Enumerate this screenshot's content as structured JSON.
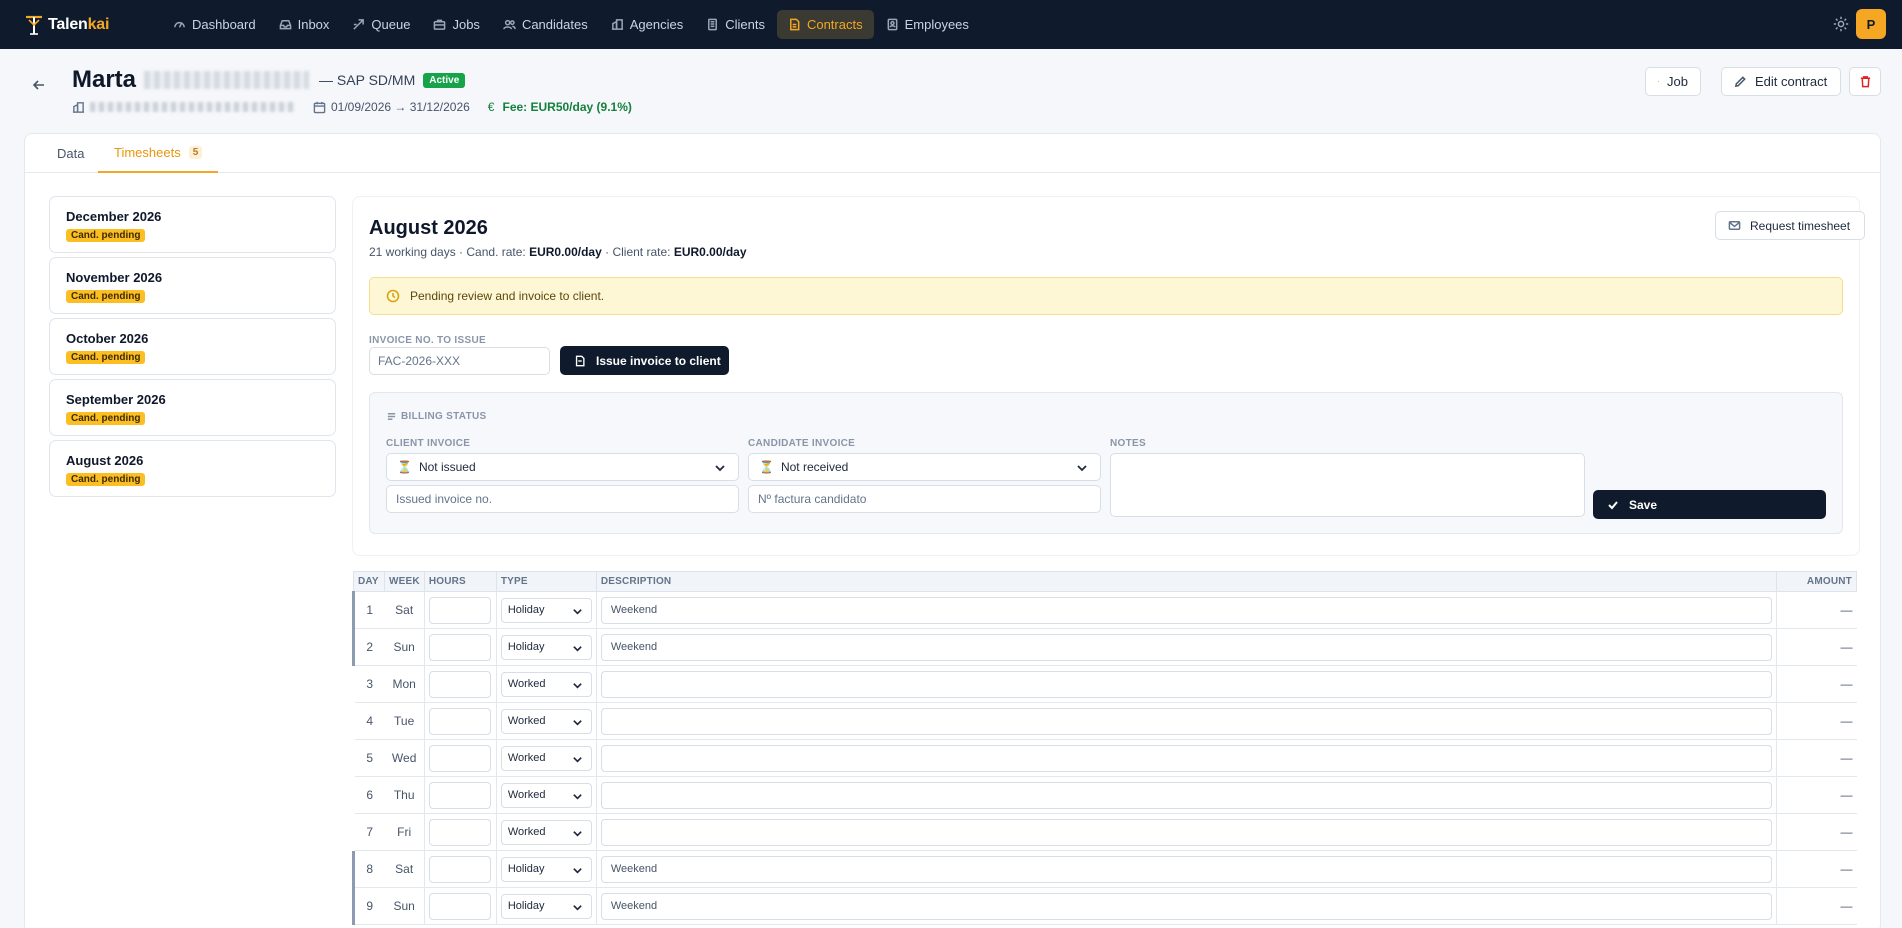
{
  "nav": {
    "logo_main": "Talen",
    "logo_accent": "kai",
    "items": [
      {
        "label": "Dashboard",
        "icon": "dashboard-icon"
      },
      {
        "label": "Inbox",
        "icon": "inbox-icon"
      },
      {
        "label": "Queue",
        "icon": "queue-icon"
      },
      {
        "label": "Jobs",
        "icon": "briefcase-icon"
      },
      {
        "label": "Candidates",
        "icon": "users-icon"
      },
      {
        "label": "Agencies",
        "icon": "building-icon"
      },
      {
        "label": "Clients",
        "icon": "clients-icon"
      },
      {
        "label": "Contracts",
        "icon": "document-icon"
      },
      {
        "label": "Employees",
        "icon": "id-card-icon"
      }
    ],
    "active": "Contracts",
    "avatar_initial": "P"
  },
  "header": {
    "name": "Marta",
    "role": "— SAP SD/MM",
    "status": "Active",
    "dates": "01/09/2026 → 31/12/2026",
    "fee_symbol": "€",
    "fee": "Fee: EUR50/day (9.1%)",
    "job_label": "Job",
    "edit_label": "Edit contract"
  },
  "tabs": {
    "data": "Data",
    "timesheets": "Timesheets",
    "timesheets_count": "5"
  },
  "months": [
    {
      "name": "December 2026",
      "status": "Cand. pending"
    },
    {
      "name": "November 2026",
      "status": "Cand. pending"
    },
    {
      "name": "October 2026",
      "status": "Cand. pending"
    },
    {
      "name": "September 2026",
      "status": "Cand. pending"
    },
    {
      "name": "August 2026",
      "status": "Cand. pending"
    }
  ],
  "detail": {
    "title": "August 2026",
    "working_days": "21 working days · Cand. rate: ",
    "cand_rate": "EUR0.00/day",
    "client_rate_label": " · Client rate: ",
    "client_rate": "EUR0.00/day",
    "request_label": "Request timesheet",
    "notice": "Pending review and invoice to client.",
    "invoice_no_label": "INVOICE NO. TO ISSUE",
    "invoice_no_placeholder": "FAC-2026-XXX",
    "issue_label": "Issue invoice to client"
  },
  "billing": {
    "title": "BILLING STATUS",
    "client_invoice_label": "CLIENT INVOICE",
    "client_invoice_value": "Not issued",
    "client_invoice_no_placeholder": "Issued invoice no.",
    "candidate_invoice_label": "CANDIDATE INVOICE",
    "candidate_invoice_value": "Not received",
    "candidate_invoice_no_placeholder": "Nº factura candidato",
    "notes_label": "NOTES",
    "notes_value": "",
    "save_label": "Save"
  },
  "table": {
    "headers": {
      "day": "DAY",
      "week": "WEEK",
      "hours": "HOURS",
      "type": "TYPE",
      "description": "DESCRIPTION",
      "amount": "AMOUNT"
    },
    "rows": [
      {
        "day": "1",
        "week": "Sat",
        "type": "Holiday",
        "desc": "Weekend",
        "amount": "—"
      },
      {
        "day": "2",
        "week": "Sun",
        "type": "Holiday",
        "desc": "Weekend",
        "amount": "—"
      },
      {
        "day": "3",
        "week": "Mon",
        "type": "Worked",
        "desc": "",
        "amount": "—"
      },
      {
        "day": "4",
        "week": "Tue",
        "type": "Worked",
        "desc": "",
        "amount": "—"
      },
      {
        "day": "5",
        "week": "Wed",
        "type": "Worked",
        "desc": "",
        "amount": "—"
      },
      {
        "day": "6",
        "week": "Thu",
        "type": "Worked",
        "desc": "",
        "amount": "—"
      },
      {
        "day": "7",
        "week": "Fri",
        "type": "Worked",
        "desc": "",
        "amount": "—"
      },
      {
        "day": "8",
        "week": "Sat",
        "type": "Holiday",
        "desc": "Weekend",
        "amount": "—"
      },
      {
        "day": "9",
        "week": "Sun",
        "type": "Holiday",
        "desc": "Weekend",
        "amount": "—"
      }
    ]
  }
}
